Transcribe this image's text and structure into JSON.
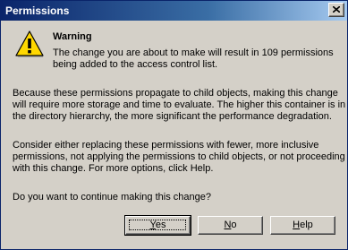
{
  "window": {
    "title": "Permissions",
    "close_icon": "close-icon"
  },
  "message": {
    "icon": "warning-icon",
    "heading": "Warning",
    "para1_lines": [
      "The change you are about to make will result in 109 permissions",
      "being added to the access control list."
    ],
    "para2_lines": [
      "Because these permissions propagate to child objects, making this change",
      "will require more storage and time to evaluate. The higher this container is in",
      "the directory hierarchy, the more significant the performance degradation."
    ],
    "para3_lines": [
      "Consider either replacing these permissions with fewer, more inclusive",
      "permissions, not applying the permissions to child objects, or not proceeding",
      "with this change. For more options, click Help."
    ],
    "question": "Do you want to continue making this change?"
  },
  "buttons": {
    "yes": "Yes",
    "no": "No",
    "help": "Help"
  },
  "colors": {
    "titlebar_start": "#0a246a",
    "titlebar_end": "#a6caf0",
    "dialog_face": "#d4d0c8",
    "warning_yellow": "#ffd800"
  }
}
